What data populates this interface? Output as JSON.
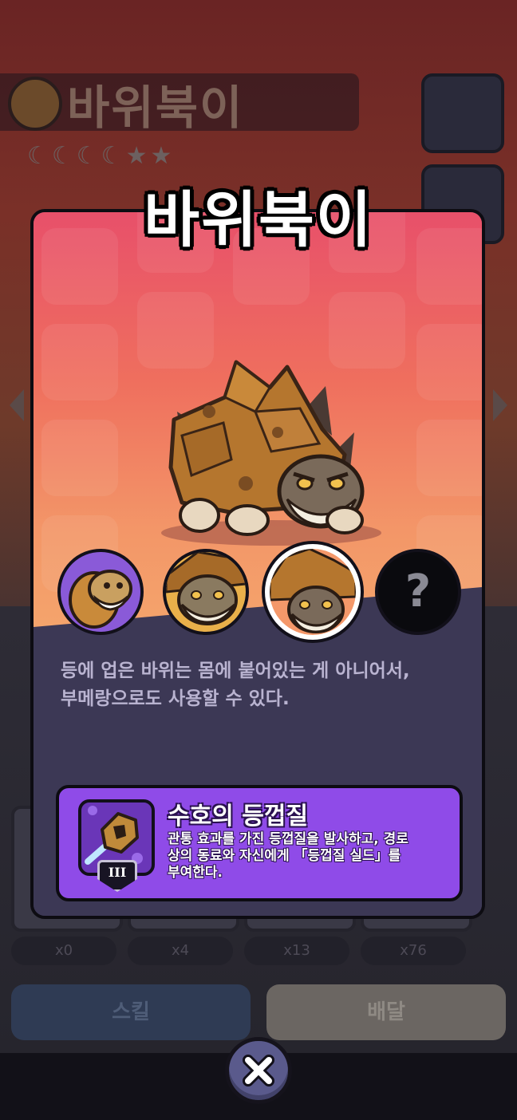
{
  "background": {
    "title": "바위북이",
    "sell_label": "스킬",
    "equip_label": "배달",
    "counts": [
      "x0",
      "x4",
      "x13",
      "x76"
    ]
  },
  "popup": {
    "title": "바위북이",
    "description_lines": [
      "등에 업은 바위는 몸에 붙어있는 게 아니어서,",
      "부메랑으로도 사용할 수 있다."
    ],
    "portrait_locked_symbol": "?",
    "skill": {
      "name": "수호의 등껍질",
      "rank": "III",
      "description_lines": [
        "관통 효과를 가진 등껍질을 발사하고, 경로",
        "상의 동료와 자신에게 「등껍질 실드」를",
        "부여한다."
      ]
    }
  },
  "icons": {
    "close": "close-icon",
    "skill": "shell-skill-icon",
    "prev": "chevron-left-icon",
    "next": "chevron-right-icon"
  },
  "colors": {
    "art_top": "#e8506a",
    "art_bottom": "#f4a56c",
    "panel": "#3c3855",
    "skill_bg": "#8f4be8",
    "close_bg": "#5a5a8c"
  }
}
